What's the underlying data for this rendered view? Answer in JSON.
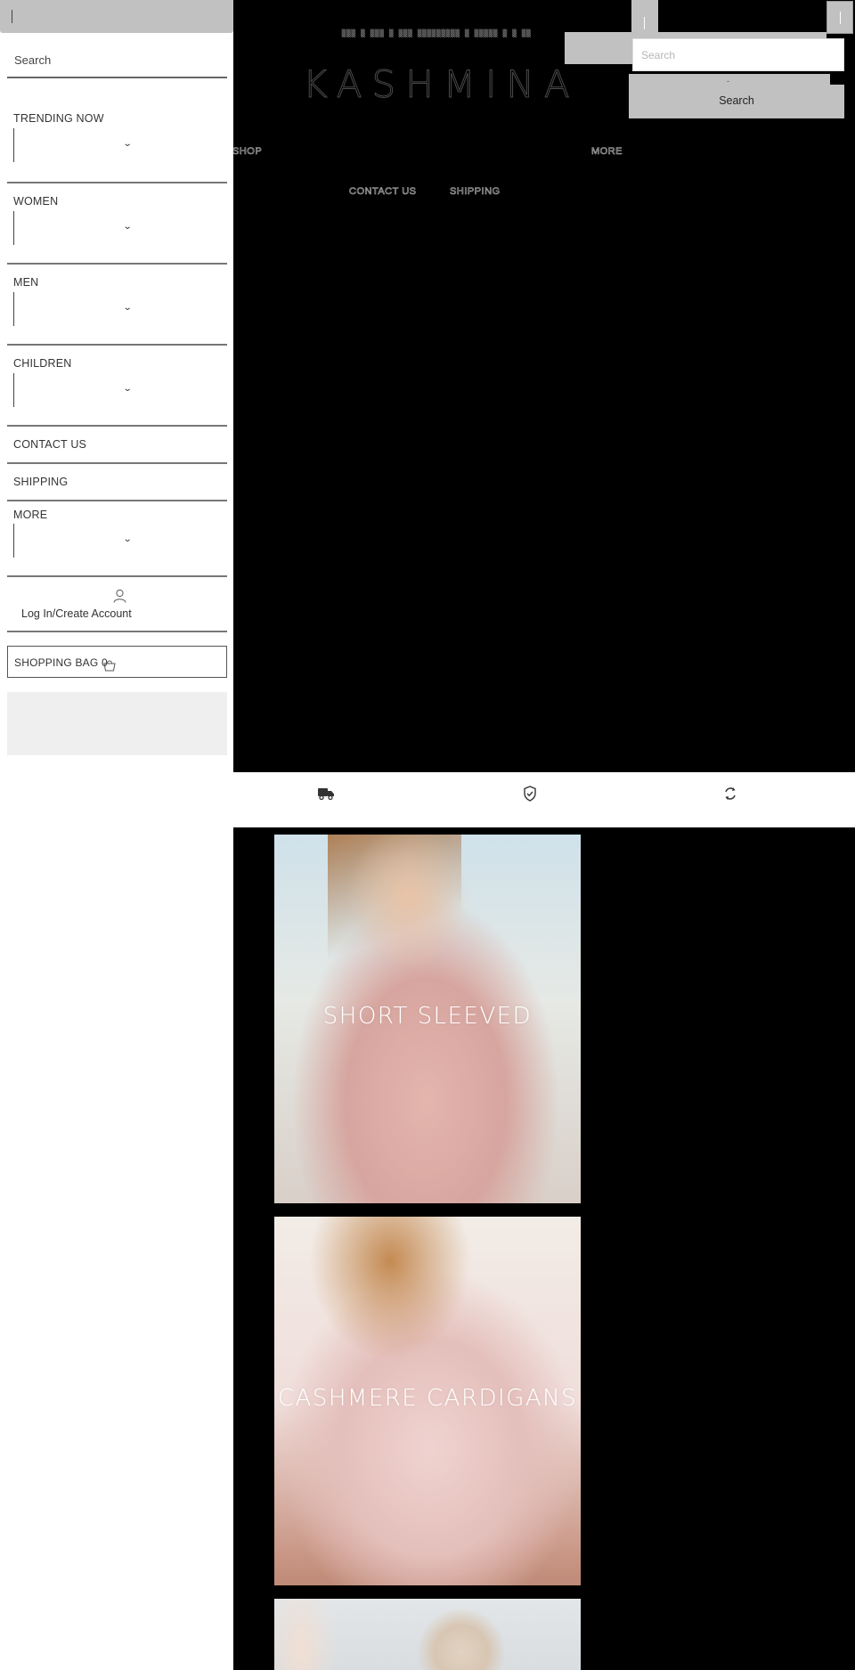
{
  "sidebar": {
    "search_label": "Search",
    "sections": [
      {
        "label": "TRENDING NOW",
        "has_dropdown": true
      },
      {
        "label": "WOMEN",
        "has_dropdown": true
      },
      {
        "label": "MEN",
        "has_dropdown": true
      },
      {
        "label": "CHILDREN",
        "has_dropdown": true
      },
      {
        "label": "CONTACT US",
        "has_dropdown": false
      },
      {
        "label": "SHIPPING",
        "has_dropdown": false
      },
      {
        "label": "MORE",
        "has_dropdown": true
      }
    ],
    "dropdown_chevron": "⌄",
    "account_label": "Log In/Create Account",
    "account_icon": "user-icon",
    "bag_label": "SHOPPING BAG 0",
    "bag_icon": "shopping-bag-icon"
  },
  "header": {
    "announcement": "▒▒▒ ▒ ▒▒▒ ▒ ▒▒▒ ▒▒▒▒▒▒▒▒▒ ▒ ▒▒▒▒▒ ▒  ▒  ▒▒",
    "logo": "KASHMINA",
    "nav": {
      "shop": "SHOP",
      "more": "MORE",
      "contact": "CONTACT US",
      "shipping": "SHIPPING"
    },
    "search": {
      "placeholder": "Search",
      "button_dash": "-",
      "button_label": "Search"
    }
  },
  "features": [
    {
      "icon": "truck-icon"
    },
    {
      "icon": "shield-check-icon"
    },
    {
      "icon": "refresh-icon"
    }
  ],
  "categories": [
    {
      "title": "SHORT SLEEVED"
    },
    {
      "title": "CASHMERE CARDIGANS"
    },
    {
      "title": ""
    }
  ],
  "colors": {
    "header_bg": "#000000",
    "sidebar_bg": "#ffffff",
    "control_grey": "#c1c1c1",
    "panel_grey": "#efefef",
    "text": "#333333"
  }
}
